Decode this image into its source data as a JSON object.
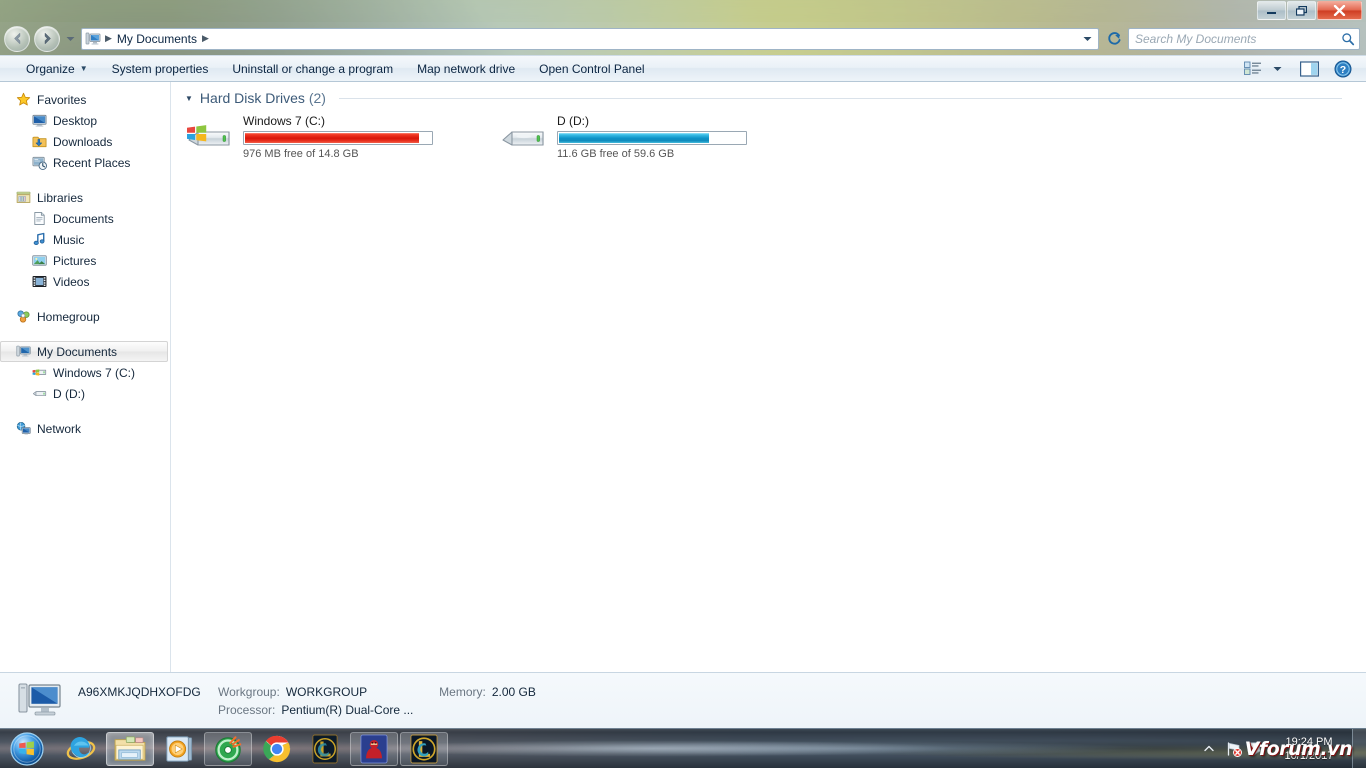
{
  "window": {
    "minimize_label": "Minimize",
    "maximize_label": "Maximize",
    "close_label": "Close"
  },
  "nav": {
    "back_label": "Back",
    "forward_label": "Forward",
    "recent_label": "Recent pages",
    "refresh_label": "Refresh",
    "breadcrumb": [
      {
        "label": "My Documents"
      }
    ],
    "address_dropdown_label": "Previous locations"
  },
  "search": {
    "placeholder": "Search My Documents",
    "value": "",
    "icon": "search-icon"
  },
  "toolbar": {
    "items": [
      {
        "label": "Organize",
        "has_caret": true
      },
      {
        "label": "System properties",
        "has_caret": false
      },
      {
        "label": "Uninstall or change a program",
        "has_caret": false
      },
      {
        "label": "Map network drive",
        "has_caret": false
      },
      {
        "label": "Open Control Panel",
        "has_caret": false
      }
    ],
    "right_icons": [
      {
        "name": "view-options-icon"
      },
      {
        "name": "chevron-down-icon"
      },
      {
        "name": "preview-pane-icon"
      },
      {
        "name": "help-icon"
      }
    ]
  },
  "sidebar": {
    "groups": [
      {
        "header": {
          "label": "Favorites",
          "icon": "star-icon"
        },
        "items": [
          {
            "label": "Desktop",
            "icon": "desktop-icon"
          },
          {
            "label": "Downloads",
            "icon": "downloads-folder-icon"
          },
          {
            "label": "Recent Places",
            "icon": "recent-places-icon"
          }
        ]
      },
      {
        "header": {
          "label": "Libraries",
          "icon": "libraries-icon"
        },
        "items": [
          {
            "label": "Documents",
            "icon": "documents-icon"
          },
          {
            "label": "Music",
            "icon": "music-icon"
          },
          {
            "label": "Pictures",
            "icon": "pictures-icon"
          },
          {
            "label": "Videos",
            "icon": "videos-icon"
          }
        ]
      },
      {
        "header": {
          "label": "Homegroup",
          "icon": "homegroup-icon"
        },
        "items": []
      },
      {
        "header": {
          "label": "My Documents",
          "icon": "computer-icon",
          "selected": true
        },
        "items": [
          {
            "label": "Windows 7 (C:)",
            "icon": "windows-drive-icon"
          },
          {
            "label": "D (D:)",
            "icon": "drive-icon"
          }
        ]
      },
      {
        "header": {
          "label": "Network",
          "icon": "network-icon"
        },
        "items": []
      }
    ]
  },
  "content": {
    "group": {
      "title": "Hard Disk Drives",
      "count": "(2)"
    },
    "drives": [
      {
        "name": "Windows 7 (C:)",
        "free_text": "976 MB free of 14.8 GB",
        "used_percent": 93.6,
        "bar_color": "#d8160a",
        "bar_style": "red",
        "icon": "windows-drive-icon"
      },
      {
        "name": "D (D:)",
        "free_text": "11.6 GB free of 59.6 GB",
        "used_percent": 80.5,
        "bar_color": "#0d93c8",
        "bar_style": "blue",
        "icon": "drive-icon"
      }
    ]
  },
  "status": {
    "computer_name": "A96XMKJQDHXOFDG",
    "workgroup_label": "Workgroup:",
    "workgroup_value": "WORKGROUP",
    "memory_label": "Memory:",
    "memory_value": "2.00 GB",
    "processor_label": "Processor:",
    "processor_value": "Pentium(R) Dual-Core  ...",
    "icon": "computer-icon"
  },
  "taskbar": {
    "start_label": "Start",
    "buttons": [
      {
        "name": "internet-explorer-icon",
        "state": "pinned",
        "label": "Internet Explorer"
      },
      {
        "name": "windows-explorer-icon",
        "state": "active",
        "label": "Windows Explorer"
      },
      {
        "name": "windows-media-player-icon",
        "state": "pinned",
        "label": "Windows Media Player"
      },
      {
        "name": "disc-burner-icon",
        "state": "running",
        "label": "Disc Utility"
      },
      {
        "name": "google-chrome-icon",
        "state": "pinned",
        "label": "Google Chrome"
      },
      {
        "name": "league-of-legends-icon",
        "state": "pinned",
        "label": "League of Legends"
      },
      {
        "name": "red-hood-app-icon",
        "state": "running",
        "label": "Garena"
      },
      {
        "name": "league-of-legends-client-icon",
        "state": "running",
        "label": "League of Legends Client"
      }
    ],
    "tray": {
      "expand_label": "Show hidden icons",
      "icons": [
        {
          "name": "network-flag-icon"
        },
        {
          "name": "action-center-flag-icon"
        }
      ]
    },
    "clock": {
      "time": "19:24 PM",
      "date": "10/1/2017"
    },
    "show_desktop_label": "Show desktop"
  },
  "watermark": {
    "text": "Vforum.vn"
  },
  "colors": {
    "accent_blue": "#3c5a78",
    "drive_red": "#d8160a",
    "drive_blue": "#0d93c8",
    "close_red": "#cf3d22"
  }
}
